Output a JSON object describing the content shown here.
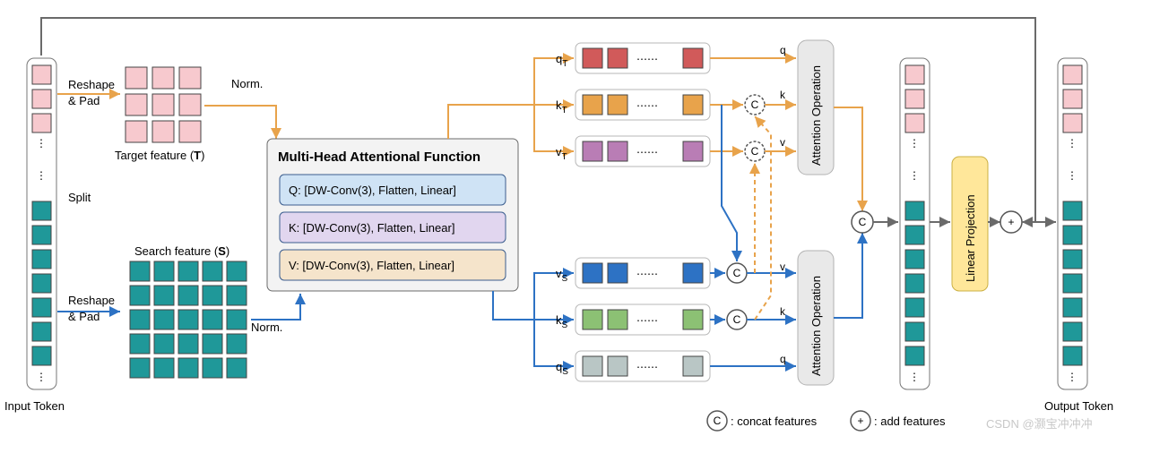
{
  "input_label": "Input Token",
  "output_label": "Output Token",
  "colors": {
    "pink": "#f7c9ce",
    "teal": "#1f9899",
    "red": "#d15a5a",
    "orange": "#e8a34b",
    "purple": "#b97db5",
    "blue": "#2d72c4",
    "green": "#8cc174",
    "grey": "#b9c6c5"
  },
  "split": "Split",
  "reshape_pad": "Reshape\n& Pad",
  "target_label": "Target feature (T)",
  "search_label": "Search feature (S)",
  "norm": "Norm.",
  "maf": {
    "title": "Multi-Head Attentional Function",
    "q": "Q: [DW-Conv(3), Flatten, Linear]",
    "k": "K: [DW-Conv(3), Flatten, Linear]",
    "v": "V: [DW-Conv(3), Flatten, Linear]"
  },
  "t": {
    "q": "q",
    "k": "k",
    "v": "v",
    "qsub": "T",
    "ksub": "T",
    "vsub": "T"
  },
  "s": {
    "q": "q",
    "k": "k",
    "v": "v",
    "qsub": "S",
    "ksub": "S",
    "vsub": "S"
  },
  "kvq": {
    "q": "q",
    "k": "k",
    "v": "v"
  },
  "att": "Attention Operation",
  "lp": "Linear Projection",
  "legend": {
    "c": "C",
    "ctext": ": concat features",
    "p": "+",
    "ptext": ": add features"
  },
  "watermark": "CSDN @灏宝冲冲冲"
}
